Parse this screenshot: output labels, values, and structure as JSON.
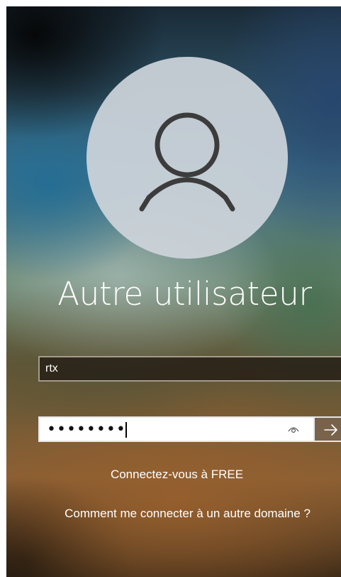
{
  "login": {
    "account_name": "Autre utilisateur",
    "username_value": "rtx",
    "password_masked": "••••••••",
    "reveal_icon": "eye-icon",
    "submit_icon": "arrow-right-icon",
    "sign_in_to": "Connectez-vous à FREE",
    "other_domain_link": "Comment me connecter à un autre domaine ?"
  },
  "colors": {
    "text": "#ffffff",
    "avatar_bg": "#cdd4da",
    "avatar_glyph": "#3c3c3c"
  }
}
